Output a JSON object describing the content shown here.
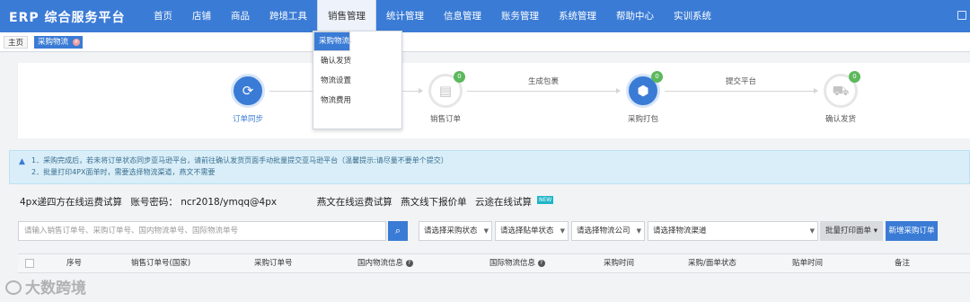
{
  "app": {
    "logo": "ERP 综合服务平台"
  },
  "nav": {
    "items": [
      "首页",
      "店铺",
      "商品",
      "跨境工具",
      "销售管理",
      "统计管理",
      "信息管理",
      "账务管理",
      "系统管理",
      "帮助中心",
      "实训系统"
    ],
    "active_index": 4
  },
  "tabs": {
    "home": "主页",
    "current": "采购物流",
    "close_glyph": "×"
  },
  "dropdown": {
    "items": [
      "销售订单",
      "采购物流",
      "确认发货",
      "物流设置",
      "物流费用"
    ],
    "selected_index": 1
  },
  "steps": {
    "items": [
      {
        "label": "订单同步",
        "icon": "sync-icon",
        "glyph": "⟳",
        "active": true,
        "badge": ""
      },
      {
        "label": "销售订单",
        "icon": "document-icon",
        "glyph": "▤",
        "active": false,
        "badge": "0"
      },
      {
        "label": "采购打包",
        "icon": "package-icon",
        "glyph": "⬢",
        "active": true,
        "badge": "0"
      },
      {
        "label": "确认发货",
        "icon": "truck-icon",
        "glyph": "⛟",
        "active": false,
        "badge": "0"
      }
    ],
    "arrows": [
      "生成包裹",
      "提交平台"
    ]
  },
  "notice": {
    "icon": "info-icon",
    "lines": [
      "1．采购完成后，若未将订单状态同步亚马逊平台，请前往确认发货页面手动批量提交亚马逊平台（温馨提示:请尽量不要单个提交）",
      "2．批量打印4PX面单时，需要选择物流渠道，燕文不需要"
    ]
  },
  "links": {
    "fourpx_calc": "4px递四方在线运费试算",
    "account": "账号密码： ncr2018/ymqq@4px",
    "yanwen_calc": "燕文在线运费试算",
    "yanwen_offline": "燕文线下报价单",
    "yuntu_calc": "云途在线试算",
    "new_badge": "NEW"
  },
  "filters": {
    "search_placeholder": "请输入销售订单号、采购订单号、国内物流单号、国际物流单号",
    "purchase_status": "请选择采购状态",
    "label_status": "请选择贴单状态",
    "logistics_company": "请选择物流公司",
    "logistics_channel": "请选择物流渠道",
    "batch_print": "批量打印面单",
    "add_purchase": "新增采购订单"
  },
  "table": {
    "columns": [
      "序号",
      "销售订单号(国家)",
      "采购订单号",
      "国内物流信息",
      "国际物流信息",
      "采购时间",
      "采购/面单状态",
      "贴单时间",
      "备注"
    ]
  },
  "watermark": "大数跨境",
  "colors": {
    "primary": "#3a7bd5",
    "success": "#5cb85c",
    "notice_bg": "#d9eef8"
  }
}
